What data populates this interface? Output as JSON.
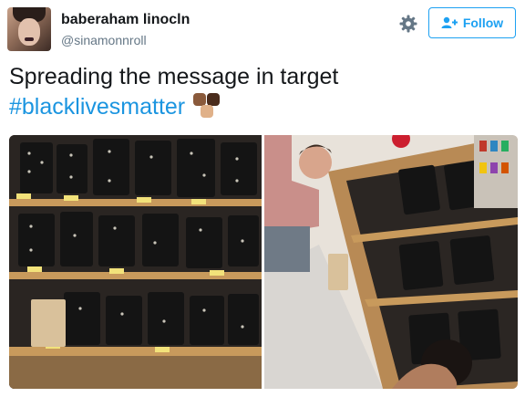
{
  "user": {
    "display_name": "baberaham linocln",
    "handle": "@sinamonnroll",
    "avatar_icon": "profile-photo"
  },
  "actions": {
    "settings_icon": "gear-icon",
    "follow_label": "Follow",
    "follow_icon": "add-user-icon"
  },
  "tweet": {
    "text": "Spreading the message in target",
    "hashtag": "#blacklivesmatter",
    "emoji": "raised-fist-emoji",
    "media": [
      {
        "description_icon": "photo-shelves-letters"
      },
      {
        "description_icon": "photo-shelves-people"
      }
    ]
  },
  "colors": {
    "accent": "#1da1f2",
    "hashtag": "#1b95e0",
    "secondary_text": "#657786"
  }
}
